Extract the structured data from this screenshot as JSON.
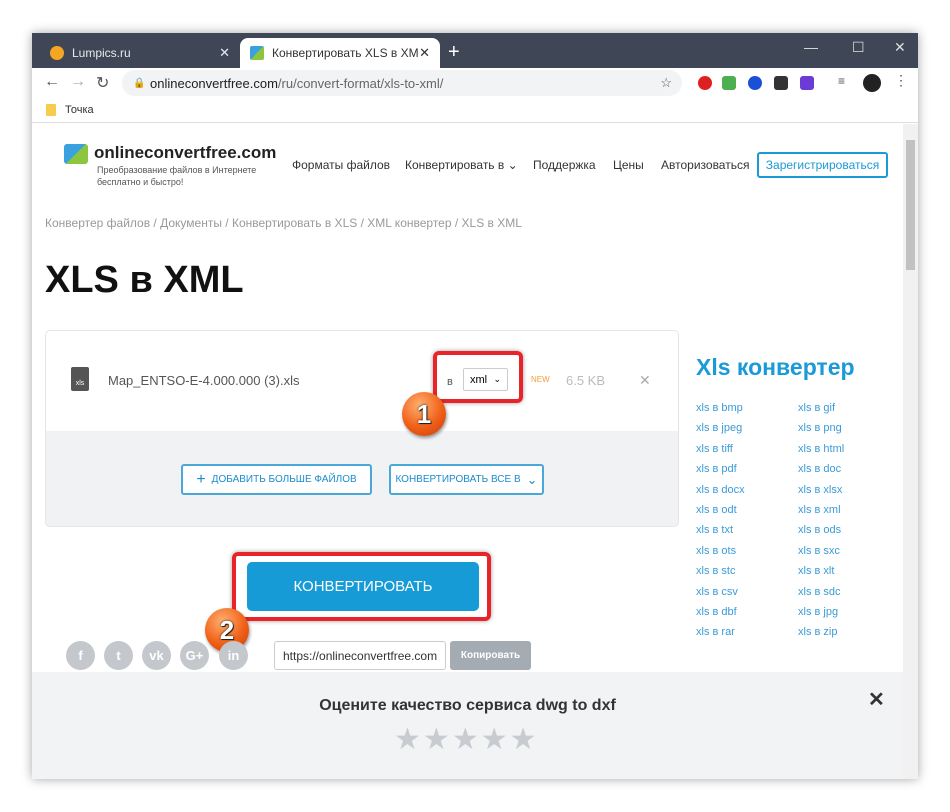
{
  "browser": {
    "tabs": [
      {
        "title": "Lumpics.ru",
        "active": false
      },
      {
        "title": "Конвертировать XLS в XML онл",
        "active": true
      }
    ],
    "address": {
      "host": "onlineconvertfree.com",
      "path": "/ru/convert-format/xls-to-xml/"
    },
    "bookmarks": [
      {
        "label": "Точка"
      }
    ]
  },
  "site": {
    "logo": "onlineconvertfree.com",
    "tagline": "Преобразование файлов в Интернете бесплатно и быстро!",
    "menu": [
      "Форматы файлов",
      "Конвертировать в",
      "Поддержка",
      "Цены",
      "Авторизоваться"
    ],
    "register": "Зарегистрироваться",
    "breadcrumb": "Конвертер файлов / Документы / Конвертировать в XLS / XML конвертер / XLS в XML",
    "title": "XLS в XML"
  },
  "file": {
    "name": "Map_ENTSO-E-4.000.000 (3).xls",
    "icon_label": "xls",
    "to_label": "в",
    "format": "xml",
    "badge": "NEW",
    "size": "6.5 KB"
  },
  "buttons": {
    "add_more": "ДОБАВИТЬ БОЛЬШЕ ФАЙЛОВ",
    "convert_all": "КОНВЕРТИРОВАТЬ ВСЕ В",
    "convert": "КОНВЕРТИРОВАТЬ",
    "copy": "Копировать"
  },
  "share": {
    "url": "https://onlineconvertfree.com",
    "networks": [
      "f",
      "t",
      "vk",
      "G+",
      "in"
    ]
  },
  "annotations": [
    "1",
    "2"
  ],
  "sidebar": {
    "title": "Xls конвертер",
    "links": [
      "xls в bmp",
      "xls в gif",
      "xls в jpeg",
      "xls в png",
      "xls в tiff",
      "xls в html",
      "xls в pdf",
      "xls в doc",
      "xls в docx",
      "xls в xlsx",
      "xls в odt",
      "xls в xml",
      "xls в txt",
      "xls в ods",
      "xls в ots",
      "xls в sxc",
      "xls в stc",
      "xls в xlt",
      "xls в csv",
      "xls в sdc",
      "xls в dbf",
      "xls в jpg",
      "xls в rar",
      "xls в zip"
    ]
  },
  "rating": {
    "title": "Оцените качество сервиса dwg to dxf",
    "stars": 5,
    "value": 0
  },
  "colors": {
    "accent": "#179bd7",
    "highlight": "#e8232a",
    "titlebar": "#3f4656"
  }
}
